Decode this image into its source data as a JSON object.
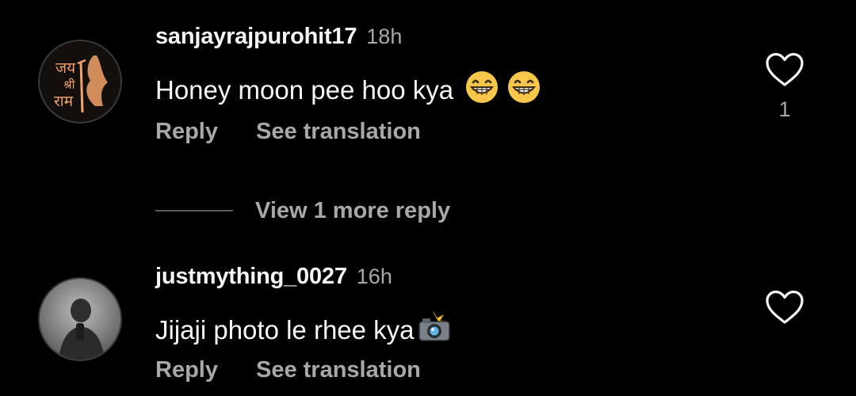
{
  "comments": [
    {
      "username": "sanjayrajpurohit17",
      "time": "18h",
      "text": "Honey moon pee hoo kya",
      "emojis": [
        "grinning-face-with-smiling-eyes",
        "grinning-face-with-smiling-eyes"
      ],
      "reply_label": "Reply",
      "translate_label": "See translation",
      "like_count": "1",
      "avatar_text": [
        "जय",
        "श्री",
        "राम"
      ],
      "avatar_colors": {
        "bg": "#120f0d",
        "accent": "#f2a26a"
      }
    },
    {
      "username": "justmything_0027",
      "time": "16h",
      "text": "Jijaji photo le rhee kya",
      "emojis": [
        "camera-with-flash"
      ],
      "reply_label": "Reply",
      "translate_label": "See translation",
      "like_count": "",
      "avatar_colors": {
        "bg": "#7a7a7a",
        "accent": "#2b2b2b"
      }
    }
  ],
  "view_more": "View 1 more reply",
  "icons": {
    "like": "heart-outline-icon",
    "grin": "grinning-face-icon",
    "camera": "camera-flash-icon"
  },
  "colors": {
    "background": "#000000",
    "primary_text": "#f5f5f5",
    "secondary_text": "#a8a8a8",
    "divider": "#5a5a5a",
    "emoji_yellow": "#f6c74a"
  }
}
